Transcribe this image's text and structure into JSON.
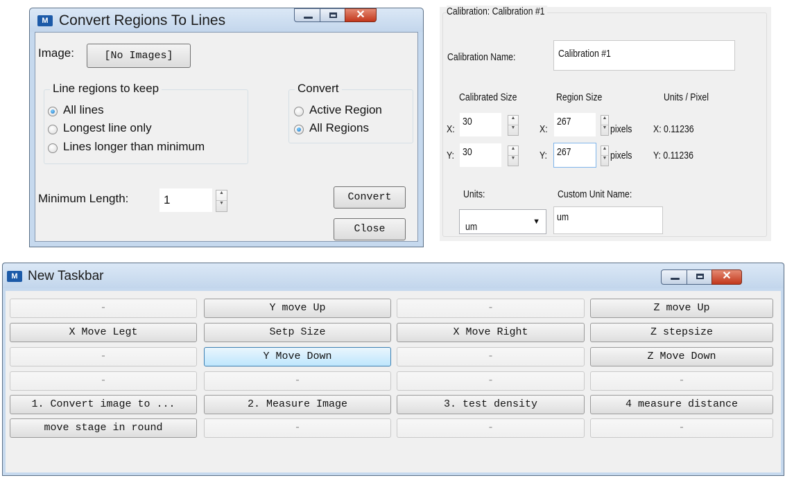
{
  "convert_window": {
    "title": "Convert Regions To Lines",
    "image_label": "Image:",
    "image_button": "[No Images]",
    "keep_group": {
      "title": "Line regions to keep",
      "options": [
        "All lines",
        "Longest line only",
        "Lines longer than minimum"
      ],
      "selected": 0
    },
    "convert_group": {
      "title": "Convert",
      "options": [
        "Active Region",
        "All Regions"
      ],
      "selected": 1
    },
    "min_length_label": "Minimum Length:",
    "min_length_value": "1",
    "convert_button": "Convert",
    "close_button": "Close"
  },
  "calibration": {
    "group_title": "Calibration: Calibration #1",
    "name_label": "Calibration Name:",
    "name_value": "Calibration #1",
    "col_calibrated": "Calibrated Size",
    "col_region": "Region Size",
    "col_units_per_pixel": "Units / Pixel",
    "x_label": "X:",
    "y_label": "Y:",
    "x_calibrated": "30",
    "y_calibrated": "30",
    "x_region": "267",
    "y_region": "267",
    "pixels_label": "pixels",
    "x_units_per_pixel": "X: 0.11236",
    "y_units_per_pixel": "Y: 0.11236",
    "units_label": "Units:",
    "units_value": "um",
    "custom_unit_label": "Custom Unit Name:",
    "custom_unit_value": "um"
  },
  "taskbar": {
    "title": "New Taskbar",
    "rows": [
      [
        "-",
        "Y move Up",
        "-",
        "Z move Up"
      ],
      [
        "X Move Legt",
        "Setp Size",
        "X Move Right",
        "Z stepsize"
      ],
      [
        "-",
        "Y Move Down",
        "-",
        "Z Move Down"
      ],
      [
        "-",
        "-",
        "-",
        "-"
      ],
      [
        "1. Convert image  to ...",
        "2. Measure Image",
        "3. test density",
        "4  measure distance"
      ],
      [
        "move stage in round",
        "-",
        "-",
        "-"
      ]
    ]
  },
  "colors": {
    "title_gradient": "#c6d9ee",
    "close_button": "#c2371c",
    "radio_checked": "#1b6fbf",
    "hover_button": "#bee6fd"
  }
}
